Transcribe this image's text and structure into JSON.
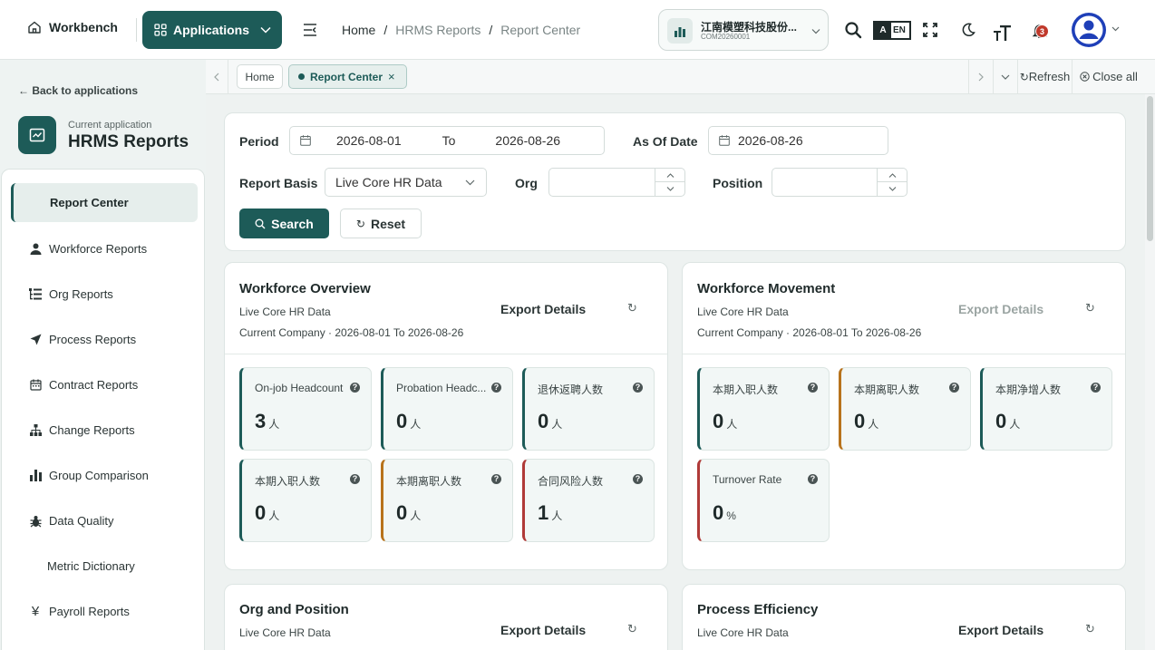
{
  "header": {
    "workbench_label": "Workbench",
    "applications_label": "Applications",
    "breadcrumb": [
      "Home",
      "HRMS Reports",
      "Report Center"
    ],
    "breadcrumb_sep": "/",
    "company_name": "江南模塑科技股份...",
    "company_code": "COM20260001",
    "lang_label": "EN",
    "notification_count": "3"
  },
  "sidebar": {
    "back_label": "← Back to applications",
    "current_app_caption": "Current application",
    "current_app_name": "HRMS Reports",
    "items": [
      {
        "label": "Report Center",
        "icon": "none",
        "active": true
      },
      {
        "label": "Workforce Reports",
        "icon": "person-icon"
      },
      {
        "label": "Org Reports",
        "icon": "org-list-icon"
      },
      {
        "label": "Process Reports",
        "icon": "send-icon"
      },
      {
        "label": "Contract Reports",
        "icon": "calendar-icon"
      },
      {
        "label": "Change Reports",
        "icon": "hierarchy-icon"
      },
      {
        "label": "Group Comparison",
        "icon": "bar-chart-icon"
      },
      {
        "label": "Data Quality",
        "icon": "bug-icon"
      },
      {
        "label": "Metric Dictionary",
        "icon": "none"
      },
      {
        "label": "Payroll Reports",
        "icon": "yen-icon"
      }
    ]
  },
  "tabs": {
    "items": [
      {
        "label": "Home"
      },
      {
        "label": "Report Center",
        "active": true
      }
    ],
    "refresh_label": "Refresh",
    "close_all_label": "Close all"
  },
  "filters": {
    "period_label": "Period",
    "period_start": "2026-08-01",
    "period_to": "To",
    "period_end": "2026-08-26",
    "as_of_label": "As Of Date",
    "as_of_value": "2026-08-26",
    "basis_label": "Report Basis",
    "basis_value": "Live Core HR Data",
    "org_label": "Org",
    "position_label": "Position",
    "search_label": "Search",
    "reset_label": "Reset"
  },
  "sections": [
    {
      "title": "Workforce Overview",
      "subtitle1": "Live Core HR Data",
      "subtitle2": "Current Company · 2026-08-01 To 2026-08-26",
      "export_label": "Export Details",
      "metrics": [
        {
          "label": "On-job Headcount",
          "value": "3",
          "unit": "人",
          "accent": "teal"
        },
        {
          "label": "Probation Headc...",
          "value": "0",
          "unit": "人",
          "accent": "teal"
        },
        {
          "label": "退休返聘人数",
          "value": "0",
          "unit": "人",
          "accent": "teal"
        },
        {
          "label": "本期入职人数",
          "value": "0",
          "unit": "人",
          "accent": "teal"
        },
        {
          "label": "本期离职人数",
          "value": "0",
          "unit": "人",
          "accent": "orange"
        },
        {
          "label": "合同风险人数",
          "value": "1",
          "unit": "人",
          "accent": "red"
        }
      ]
    },
    {
      "title": "Workforce Movement",
      "subtitle1": "Live Core HR Data",
      "subtitle2": "Current Company · 2026-08-01 To 2026-08-26",
      "export_label": "Export Details",
      "metrics": [
        {
          "label": "本期入职人数",
          "value": "0",
          "unit": "人",
          "accent": "teal"
        },
        {
          "label": "本期离职人数",
          "value": "0",
          "unit": "人",
          "accent": "orange"
        },
        {
          "label": "本期净增人数",
          "value": "0",
          "unit": "人",
          "accent": "teal"
        },
        {
          "label": "Turnover Rate",
          "value": "0",
          "unit": "%",
          "accent": "red"
        }
      ]
    },
    {
      "title": "Org and Position",
      "subtitle1": "Live Core HR Data",
      "export_label": "Export Details"
    },
    {
      "title": "Process Efficiency",
      "subtitle1": "Live Core HR Data",
      "export_label": "Export Details"
    }
  ],
  "colors": {
    "primary": "#1d5b58",
    "accent_orange": "#b8731c",
    "accent_red": "#b03a38",
    "badge_red": "#c0392b"
  }
}
